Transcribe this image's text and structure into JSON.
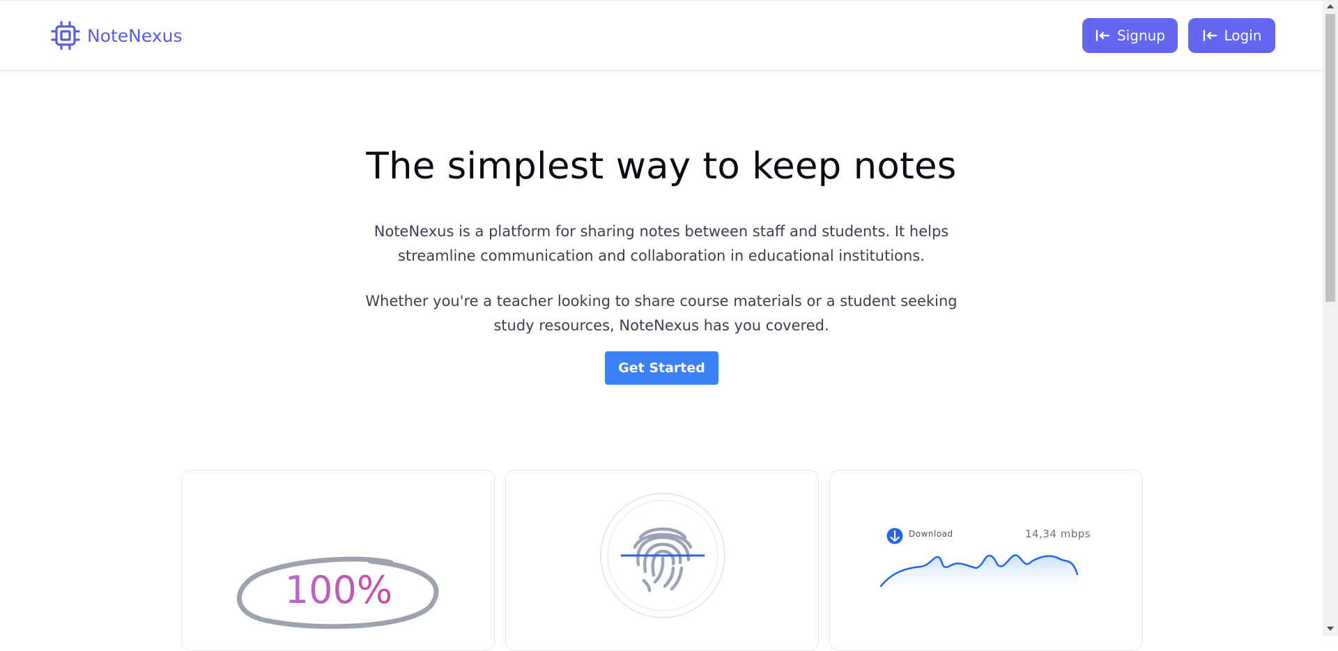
{
  "app": {
    "brand_name": "NoteNexus",
    "brand_icon": "cpu-chip-icon",
    "accent_color": "#6366f1",
    "cta_color": "#3b82f6"
  },
  "nav": {
    "signup_label": "Signup",
    "login_label": "Login",
    "button_icon": "arrow-left-bar-icon"
  },
  "hero": {
    "title": "The simplest way to keep notes",
    "description_1": "NoteNexus is a platform for sharing notes between staff and students. It helps streamline communication and collaboration in educational institutions.",
    "description_2": "Whether you're a teacher looking to share course materials or a student seeking study resources, NoteNexus has you covered.",
    "cta_label": "Get Started"
  },
  "features": {
    "card1": {
      "value_text": "100%"
    },
    "card2": {
      "icon": "fingerprint-icon"
    },
    "card3": {
      "download_label": "Download",
      "speed": "14,34 mbps",
      "icon": "download-arrow-icon"
    }
  }
}
